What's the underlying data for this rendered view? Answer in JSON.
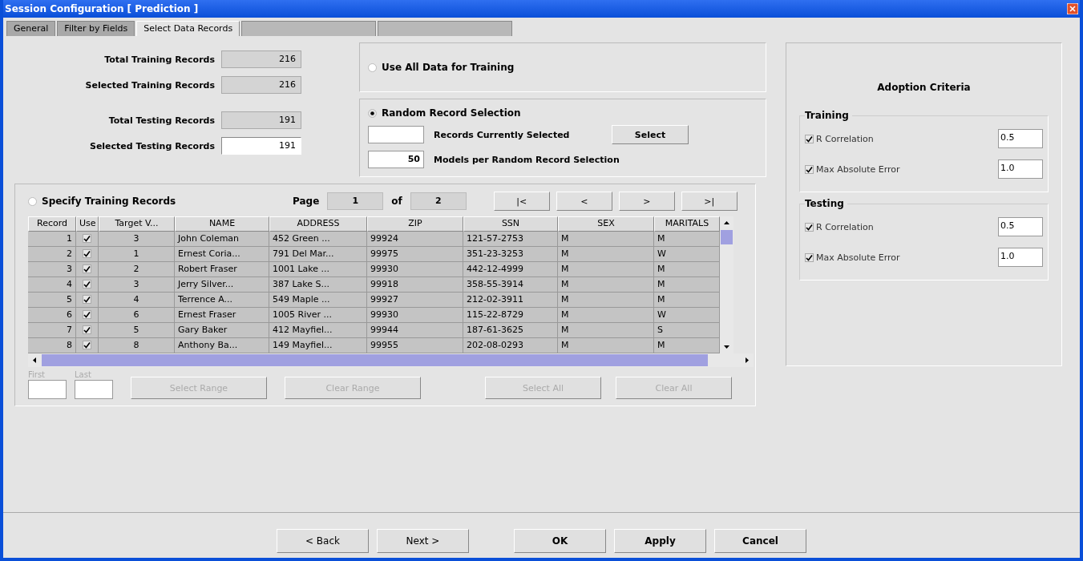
{
  "window": {
    "title": "Session Configuration [ Prediction ]"
  },
  "tabs": [
    {
      "label": "General",
      "selected": false,
      "disabled": false
    },
    {
      "label": "Filter by Fields",
      "selected": false,
      "disabled": false
    },
    {
      "label": "Select Data Records",
      "selected": true,
      "disabled": false
    },
    {
      "selected": false,
      "disabled": true
    },
    {
      "selected": false,
      "disabled": true
    }
  ],
  "counts": [
    {
      "label": "Total Training Records",
      "value": "216",
      "editable": false
    },
    {
      "label": "Selected Training Records",
      "value": "216",
      "editable": false
    },
    {
      "label": "Total Testing Records",
      "value": "191",
      "editable": false
    },
    {
      "label": "Selected Testing Records",
      "value": "191",
      "editable": true
    }
  ],
  "use_all": {
    "label": "Use All Data for Training",
    "selected": false
  },
  "random": {
    "label": "Random Record Selection",
    "selected": true,
    "current_label": "Records Currently Selected",
    "select_button": "Select",
    "models_value": "50",
    "models_label": "Models per Random Record Selection"
  },
  "specify": {
    "label": "Specify Training Records",
    "selected": false,
    "page_label": "Page",
    "page": "1",
    "of_label": "of",
    "pages": "2",
    "nav": [
      "|<",
      "<",
      ">",
      ">|"
    ]
  },
  "table": {
    "columns": [
      "Record",
      "Use",
      "Target V...",
      "NAME",
      "ADDRESS",
      "ZIP",
      "SSN",
      "SEX",
      "MARITALS"
    ],
    "rows": [
      {
        "record": "1",
        "use": true,
        "target": "3",
        "name": "John Coleman",
        "address": "452 Green ...",
        "zip": "99924",
        "ssn": "121-57-2753",
        "sex": "M",
        "marital": "M"
      },
      {
        "record": "2",
        "use": true,
        "target": "1",
        "name": "Ernest Coria...",
        "address": "791 Del Mar...",
        "zip": "99975",
        "ssn": "351-23-3253",
        "sex": "M",
        "marital": "W"
      },
      {
        "record": "3",
        "use": true,
        "target": "2",
        "name": "Robert Fraser",
        "address": "1001 Lake ...",
        "zip": "99930",
        "ssn": "442-12-4999",
        "sex": "M",
        "marital": "M"
      },
      {
        "record": "4",
        "use": true,
        "target": "3",
        "name": "Jerry Silver...",
        "address": "387 Lake S...",
        "zip": "99918",
        "ssn": "358-55-3914",
        "sex": "M",
        "marital": "M"
      },
      {
        "record": "5",
        "use": true,
        "target": "4",
        "name": "Terrence A...",
        "address": "549 Maple ...",
        "zip": "99927",
        "ssn": "212-02-3911",
        "sex": "M",
        "marital": "M"
      },
      {
        "record": "6",
        "use": true,
        "target": "6",
        "name": "Ernest Fraser",
        "address": "1005 River ...",
        "zip": "99930",
        "ssn": "115-22-8729",
        "sex": "M",
        "marital": "W"
      },
      {
        "record": "7",
        "use": true,
        "target": "5",
        "name": "Gary Baker",
        "address": "412 Mayfiel...",
        "zip": "99944",
        "ssn": "187-61-3625",
        "sex": "M",
        "marital": "S"
      },
      {
        "record": "8",
        "use": true,
        "target": "8",
        "name": "Anthony Ba...",
        "address": "149 Mayfiel...",
        "zip": "99955",
        "ssn": "202-08-0293",
        "sex": "M",
        "marital": "M"
      }
    ]
  },
  "range": {
    "first_label": "First",
    "last_label": "Last",
    "buttons": [
      {
        "label": "Select Range",
        "disabled": true
      },
      {
        "label": "Clear Range",
        "disabled": true
      },
      {
        "label": "Select All",
        "disabled": true
      },
      {
        "label": "Clear All",
        "disabled": true
      }
    ]
  },
  "adoption": {
    "title": "Adoption Criteria",
    "groups": [
      {
        "title": "Training",
        "criteria": [
          {
            "label": "R Correlation",
            "checked": true,
            "value": "0.5"
          },
          {
            "label": "Max Absolute Error",
            "checked": true,
            "value": "1.0"
          }
        ]
      },
      {
        "title": "Testing",
        "criteria": [
          {
            "label": "R Correlation",
            "checked": true,
            "value": "0.5"
          },
          {
            "label": "Max Absolute Error",
            "checked": true,
            "value": "1.0"
          }
        ]
      }
    ]
  },
  "buttons": [
    {
      "label": "< Back",
      "disabled": false
    },
    {
      "label": "Next >",
      "disabled": false
    },
    {
      "label": "OK",
      "disabled": false
    },
    {
      "label": "Apply",
      "disabled": false
    },
    {
      "label": "Cancel",
      "disabled": false
    }
  ]
}
